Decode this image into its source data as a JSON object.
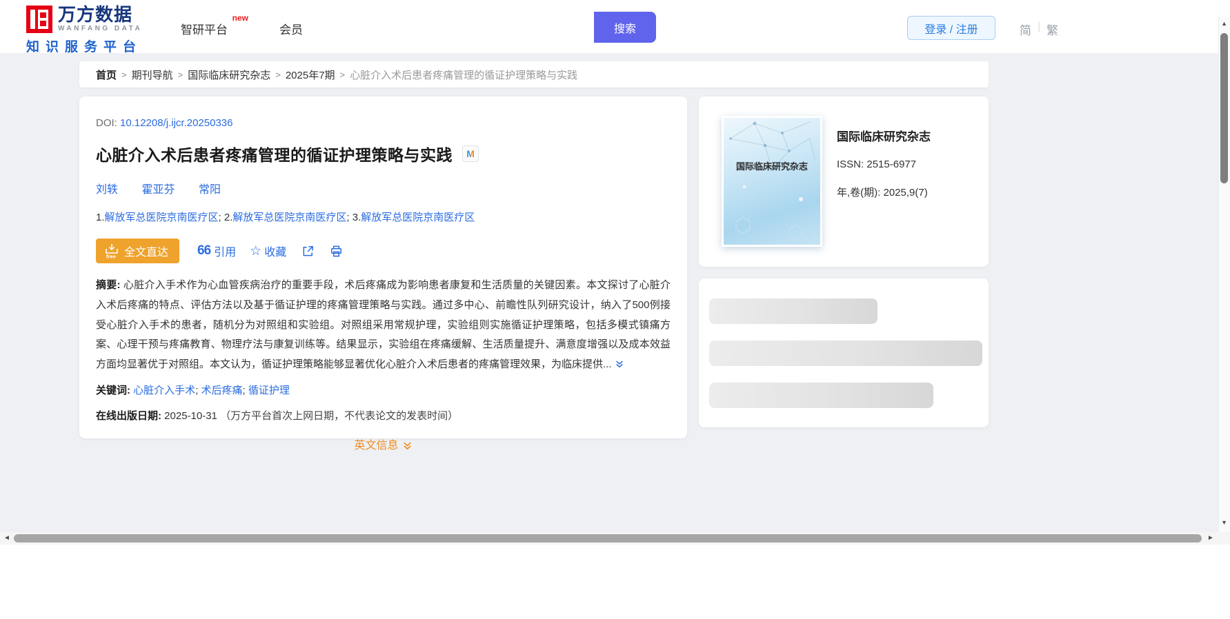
{
  "header": {
    "logo": {
      "cn": "万方数据",
      "en": "WANFANG DATA",
      "sub": "知识服务平台"
    },
    "nav": [
      {
        "label": "智研平台",
        "badge": "new"
      },
      {
        "label": "会员"
      }
    ],
    "search": {
      "button": "搜索",
      "value": ""
    },
    "login_label": "登录 / 注册",
    "lang": {
      "simplified": "简",
      "traditional": "繁"
    }
  },
  "breadcrumb": {
    "separator": ">",
    "items": [
      {
        "label": "首页"
      },
      {
        "label": "期刊导航"
      },
      {
        "label": "国际临床研究杂志"
      },
      {
        "label": "2025年7期"
      },
      {
        "label": "心脏介入术后患者疼痛管理的循证护理策略与实践"
      }
    ]
  },
  "article": {
    "doi_label": "DOI: ",
    "doi": "10.12208/j.ijcr.20250336",
    "title": "心脏介入术后患者疼痛管理的循证护理策略与实践",
    "badge_letter": "M",
    "authors": [
      "刘轶",
      "霍亚芬",
      "常阳"
    ],
    "affiliations": [
      {
        "prefix": "1.",
        "name": "解放军总医院京南医疗区",
        "sep": "; "
      },
      {
        "prefix": "2.",
        "name": "解放军总医院京南医疗区",
        "sep": "; "
      },
      {
        "prefix": "3.",
        "name": "解放军总医院京南医疗区",
        "sep": ""
      }
    ],
    "actions": {
      "fulltext": "全文直达",
      "fulltext_icon_note": "free",
      "cite_glyph": "66",
      "cite": "引用",
      "favorite_glyph": "☆",
      "favorite": "收藏"
    },
    "abstract_label": "摘要: ",
    "abstract": "心脏介入手术作为心血管疾病治疗的重要手段，术后疼痛成为影响患者康复和生活质量的关键因素。本文探讨了心脏介入术后疼痛的特点、评估方法以及基于循证护理的疼痛管理策略与实践。通过多中心、前瞻性队列研究设计，纳入了500例接受心脏介入手术的患者，随机分为对照组和实验组。对照组采用常规护理，实验组则实施循证护理策略，包括多模式镇痛方案、心理干预与疼痛教育、物理疗法与康复训练等。结果显示，实验组在疼痛缓解、生活质量提升、满意度增强以及成本效益方面均显著优于对照组。本文认为，循证护理策略能够显著优化心脏介入术后患者的疼痛管理效果，为临床提供...",
    "keywords_label": "关键词: ",
    "keywords": [
      {
        "text": "心脏介入手术",
        "sep": "; "
      },
      {
        "text": "术后疼痛",
        "sep": "; "
      },
      {
        "text": "循证护理",
        "sep": ""
      }
    ],
    "online_date_label": "在线出版日期: ",
    "online_date": "2025-10-31",
    "online_date_note": "（万方平台首次上网日期，不代表论文的发表时间）",
    "english_toggle": "英文信息"
  },
  "journal": {
    "cover_title": "国际临床研究杂志",
    "name": "国际临床研究杂志",
    "issn_label": "ISSN: ",
    "issn": "2515-6977",
    "volume_label": "年,卷(期): ",
    "volume": "2025,9(7)"
  },
  "colors": {
    "link_blue": "#2b6cdf",
    "button_orange": "#efa32d",
    "english_orange": "#ef8d1f",
    "search_purple": "#6064ec",
    "logo_red": "#e60013",
    "logo_navy": "#16377d",
    "page_bg": "#eef0f4"
  }
}
